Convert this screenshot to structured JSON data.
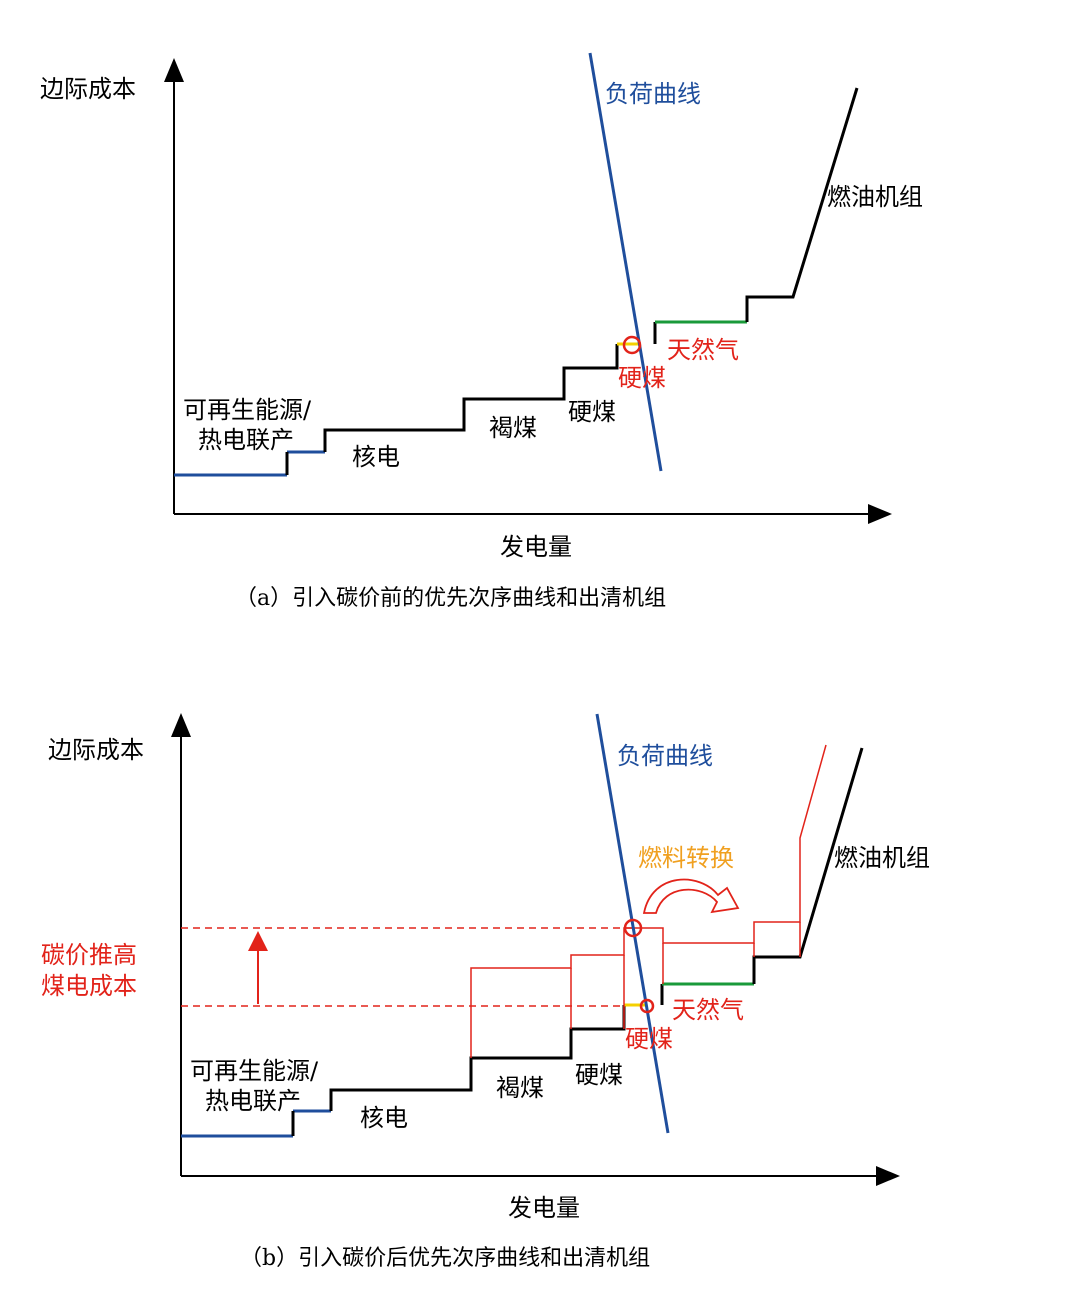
{
  "panel_a": {
    "y_axis": "边际成本",
    "x_axis": "发电量",
    "demand": "负荷曲线",
    "renewable_1": "可再生能源/",
    "renewable_2": "热电联产",
    "nuclear": "核电",
    "lignite": "褐煤",
    "hard_coal": "硬煤",
    "marginal_unit": "硬煤",
    "gas": "天然气",
    "oil": "燃油机组",
    "caption": "（a）引入碳价前的优先次序曲线和出清机组"
  },
  "panel_b": {
    "y_axis": "边际成本",
    "x_axis": "发电量",
    "demand": "负荷曲线",
    "carbon_1": "碳价推高",
    "carbon_2": "煤电成本",
    "fuel_switch": "燃料转换",
    "renewable_1": "可再生能源/",
    "renewable_2": "热电联产",
    "nuclear": "核电",
    "lignite": "褐煤",
    "hard_coal": "硬煤",
    "marginal_unit": "硬煤",
    "gas": "天然气",
    "oil": "燃油机组",
    "caption": "（b）引入碳价后优先次序曲线和出清机组"
  },
  "colors": {
    "axis": "#000000",
    "renewable": "#1f4e9c",
    "demand": "#1f4e9c",
    "coal": "#000000",
    "hard_coal_marginal": "#f5d000",
    "gas": "#1a9a3a",
    "carbon": "#e2231a",
    "fuel_switch_text": "#f0a020"
  }
}
